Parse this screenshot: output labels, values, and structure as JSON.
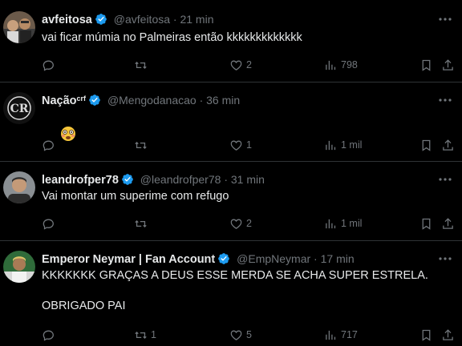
{
  "tweets": [
    {
      "name": "avfeitosa",
      "name_sup": "",
      "verified": true,
      "handle": "@avfeitosa",
      "time": "21 min",
      "text": "vai ficar múmia no Palmeiras então kkkkkkkkkkkkk",
      "replies": "",
      "retweets": "",
      "likes": "2",
      "views": "798"
    },
    {
      "name": "Nação",
      "name_sup": "crf",
      "verified": true,
      "handle": "@Mengodanacao",
      "time": "36 min",
      "text": "",
      "emoji": "flushed-face-emoji",
      "replies": "",
      "retweets": "",
      "likes": "1",
      "views": "1 mil"
    },
    {
      "name": "leandrofper78",
      "name_sup": "",
      "verified": true,
      "handle": "@leandrofper78",
      "time": "31 min",
      "text": "Vai montar um superime com refugo",
      "replies": "",
      "retweets": "",
      "likes": "2",
      "views": "1 mil"
    },
    {
      "name": "Emperor Neymar | Fan Account",
      "name_sup": "",
      "verified": true,
      "handle": "@EmpNeymar",
      "time": "17 min",
      "text": "KKKKKKK GRAÇAS A DEUS ESSE MERDA SE ACHA SUPER ESTRELA.\n\nOBRIGADO PAI",
      "replies": "",
      "retweets": "1",
      "likes": "5",
      "views": "717"
    }
  ],
  "separator": "·",
  "colors": {
    "background": "#000000",
    "text": "#e7e9ea",
    "secondary": "#71767b",
    "verified": "#1d9bf0",
    "divider": "#2f3336"
  }
}
